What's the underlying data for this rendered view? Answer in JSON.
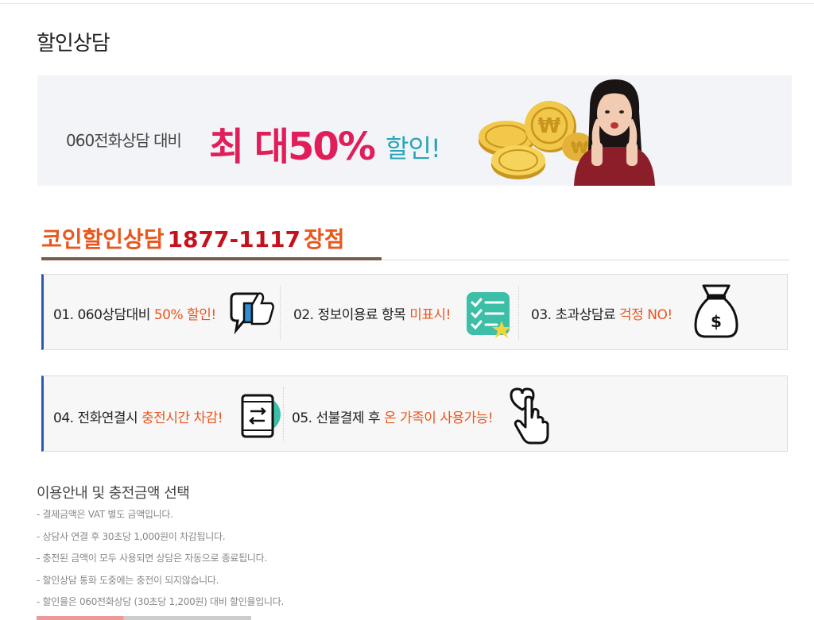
{
  "page": {
    "title": "할인상담"
  },
  "banner": {
    "lead": "060전화상담 대비",
    "big": "최 대50%",
    "small": "할인!",
    "colors": {
      "big": "#e01e5a",
      "small": "#2aa5b8"
    }
  },
  "promo": {
    "label_before": "코인할인상담",
    "number": "1877-1117",
    "label_after": "장점",
    "colors": {
      "label": "#e8571e",
      "number": "#c4111b",
      "underline": "#7a5b48"
    }
  },
  "features": [
    {
      "prefix": "01. 060상담대비 ",
      "highlight": "50% 할인!",
      "icon": "thumbs-up-chat-icon"
    },
    {
      "prefix": "02. 정보이용료 항목 ",
      "highlight": "미표시!",
      "icon": "checklist-star-icon"
    },
    {
      "prefix": "03. 초과상담료 ",
      "highlight": "걱정 NO!",
      "icon": "money-bag-icon"
    },
    {
      "prefix": "04.  전화연결시 ",
      "highlight": "충전시간 차감!",
      "icon": "phone-transfer-icon"
    },
    {
      "prefix": "05. 선불결제 후 ",
      "highlight": "온 가족이 사용가능!",
      "icon": "heart-tap-icon"
    }
  ],
  "guide": {
    "title": "이용안내 및 충전금액 선택",
    "items": [
      "결제금액은 VAT 별도 금액입니다.",
      "상담사 연결 후 30초당 1,000원이 차감됩니다.",
      "충전된 금액이 모두 사용되면 상담은 자동으로 종료됩니다.",
      "할인상담 통화 도중에는 충전이 되지않습니다.",
      "할인율은 060전화상담 (30초당 1,200원) 대비 할인율입니다."
    ]
  },
  "colors": {
    "accent_border": "#2a5ab0",
    "highlight": "#e8571e"
  }
}
